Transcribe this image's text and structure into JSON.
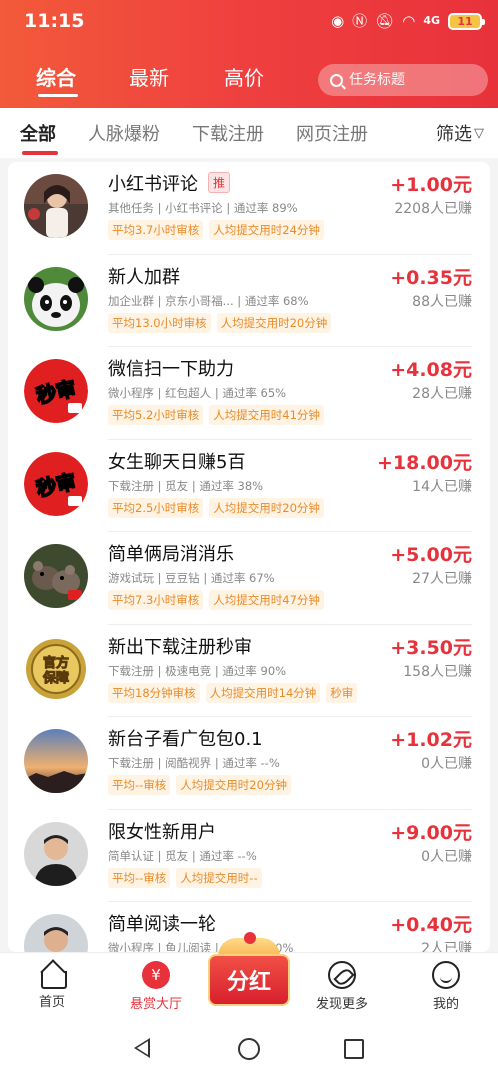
{
  "status_bar": {
    "time": "11:15",
    "icons": [
      "eye-icon",
      "nfc-icon",
      "mute-icon",
      "wifi-icon",
      "signal-4g-icon"
    ],
    "signal_label": "4G",
    "battery": "11"
  },
  "top_tabs": [
    {
      "label": "综合",
      "active": true
    },
    {
      "label": "最新",
      "active": false
    },
    {
      "label": "高价",
      "active": false
    }
  ],
  "search": {
    "placeholder": "任务标题"
  },
  "sub_tabs": [
    {
      "label": "全部",
      "active": true
    },
    {
      "label": "人脉爆粉",
      "active": false
    },
    {
      "label": "下载注册",
      "active": false
    },
    {
      "label": "网页注册",
      "active": false
    }
  ],
  "filter_label": "筛选",
  "tasks": [
    {
      "title": "小红书评论",
      "badge": "推",
      "meta": "其他任务 | 小红书评论 | 通过率 89%",
      "tags": [
        "平均3.7小时审核",
        "人均提交用时24分钟"
      ],
      "price": "+1.00元",
      "earned": "2208人已赚",
      "avatar": "photo"
    },
    {
      "title": "新人加群",
      "badge": "",
      "meta": "加企业群 | 京东小哥福... | 通过率 68%",
      "tags": [
        "平均13.0小时审核",
        "人均提交用时20分钟"
      ],
      "price": "+0.35元",
      "earned": "88人已赚",
      "avatar": "panda"
    },
    {
      "title": "微信扫一下助力",
      "badge": "",
      "meta": "微小程序 | 红包超人 | 通过率 65%",
      "tags": [
        "平均5.2小时审核",
        "人均提交用时41分钟"
      ],
      "price": "+4.08元",
      "earned": "28人已赚",
      "avatar": "秒审"
    },
    {
      "title": "女生聊天日赚5百",
      "badge": "",
      "meta": "下载注册 | 觅友 | 通过率 38%",
      "tags": [
        "平均2.5小时审核",
        "人均提交用时20分钟"
      ],
      "price": "+18.00元",
      "earned": "14人已赚",
      "avatar": "秒审"
    },
    {
      "title": "简单俩局消消乐",
      "badge": "",
      "meta": "游戏试玩 | 豆豆钻 | 通过率 67%",
      "tags": [
        "平均7.3小时审核",
        "人均提交用时47分钟"
      ],
      "price": "+5.00元",
      "earned": "27人已赚",
      "avatar": "photo"
    },
    {
      "title": "新出下载注册秒审",
      "badge": "",
      "meta": "下载注册 | 极速电竞 | 通过率 90%",
      "tags": [
        "平均18分钟审核",
        "人均提交用时14分钟",
        "秒审"
      ],
      "price": "+3.50元",
      "earned": "158人已赚",
      "avatar": "官方保障"
    },
    {
      "title": "新台子看广包包0.1",
      "badge": "",
      "meta": "下载注册 | 阅酷视界 | 通过率 --%",
      "tags": [
        "平均--审核",
        "人均提交用时20分钟"
      ],
      "price": "+1.02元",
      "earned": "0人已赚",
      "avatar": "photo"
    },
    {
      "title": "限女性新用户",
      "badge": "",
      "meta": "简单认证 | 觅友 | 通过率 --%",
      "tags": [
        "平均--审核",
        "人均提交用时--"
      ],
      "price": "+9.00元",
      "earned": "0人已赚",
      "avatar": "photo"
    },
    {
      "title": "简单阅读一轮",
      "badge": "",
      "meta": "微小程序 | 鱼儿阅读 | 通过率 100%",
      "tags": [],
      "price": "+0.40元",
      "earned": "2人已赚",
      "avatar": "photo"
    }
  ],
  "bottom_nav": [
    {
      "label": "首页",
      "icon": "home-icon",
      "active": false
    },
    {
      "label": "悬赏大厅",
      "icon": "yen-icon",
      "active": true
    },
    {
      "label": "分红",
      "icon": "gift-icon",
      "active": false
    },
    {
      "label": "发现更多",
      "icon": "compass-icon",
      "active": false
    },
    {
      "label": "我的",
      "icon": "smile-icon",
      "active": false
    }
  ],
  "colors": {
    "accent": "#e8323b",
    "tag_text": "#e98b2a",
    "tag_bg": "#fff3e3"
  }
}
